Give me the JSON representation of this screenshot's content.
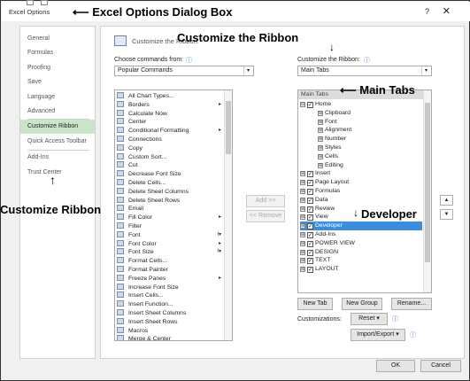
{
  "window": {
    "title": "Excel Options",
    "help": "?",
    "close": "✕"
  },
  "annotations": {
    "dialog": "Excel Options Dialog Box",
    "customize_the_ribbon": "Customize the Ribbon",
    "main_tabs": "Main Tabs",
    "developer": "Developer",
    "customize_ribbon": "Customize Ribbon"
  },
  "sidebar": {
    "items": [
      {
        "label": "General"
      },
      {
        "label": "Formulas"
      },
      {
        "label": "Proofing"
      },
      {
        "label": "Save"
      },
      {
        "label": "Language"
      },
      {
        "label": "Advanced"
      },
      {
        "label": "Customize Ribbon"
      },
      {
        "label": "Quick Access Toolbar"
      },
      {
        "label": "Add-Ins"
      },
      {
        "label": "Trust Center"
      }
    ]
  },
  "main": {
    "header": "Customize the Ribbon.",
    "choose_label": "Choose commands from:",
    "choose_value": "Popular Commands",
    "ribbon_label": "Customize the Ribbon:",
    "ribbon_value": "Main Tabs",
    "commands": [
      {
        "label": "All Chart Types..."
      },
      {
        "label": "Borders",
        "sub": "▸"
      },
      {
        "label": "Calculate Now"
      },
      {
        "label": "Center"
      },
      {
        "label": "Conditional Formatting",
        "sub": "▸"
      },
      {
        "label": "Connections"
      },
      {
        "label": "Copy"
      },
      {
        "label": "Custom Sort..."
      },
      {
        "label": "Cut"
      },
      {
        "label": "Decrease Font Size"
      },
      {
        "label": "Delete Cells..."
      },
      {
        "label": "Delete Sheet Columns"
      },
      {
        "label": "Delete Sheet Rows"
      },
      {
        "label": "Email"
      },
      {
        "label": "Fill Color",
        "sub": "▸"
      },
      {
        "label": "Filter"
      },
      {
        "label": "Font",
        "sub": "I▾"
      },
      {
        "label": "Font Color",
        "sub": "▸"
      },
      {
        "label": "Font Size",
        "sub": "I▾"
      },
      {
        "label": "Format Cells..."
      },
      {
        "label": "Format Painter"
      },
      {
        "label": "Freeze Panes",
        "sub": "▸"
      },
      {
        "label": "Increase Font Size"
      },
      {
        "label": "Insert Cells..."
      },
      {
        "label": "Insert Function..."
      },
      {
        "label": "Insert Sheet Columns"
      },
      {
        "label": "Insert Sheet Rows"
      },
      {
        "label": "Macros"
      },
      {
        "label": "Merge & Center"
      }
    ],
    "tabs_header": "Main Tabs",
    "tree": [
      {
        "label": "Home",
        "level": 0,
        "exp": "⊟",
        "check": true
      },
      {
        "label": "Clipboard",
        "level": 1,
        "exp": "⊞"
      },
      {
        "label": "Font",
        "level": 1,
        "exp": "⊞"
      },
      {
        "label": "Alignment",
        "level": 1,
        "exp": "⊞"
      },
      {
        "label": "Number",
        "level": 1,
        "exp": "⊞"
      },
      {
        "label": "Styles",
        "level": 1,
        "exp": "⊞"
      },
      {
        "label": "Cells",
        "level": 1,
        "exp": "⊞"
      },
      {
        "label": "Editing",
        "level": 1,
        "exp": "⊞"
      },
      {
        "label": "Insert",
        "level": 0,
        "exp": "⊞",
        "check": true
      },
      {
        "label": "Page Layout",
        "level": 0,
        "exp": "⊞",
        "check": true
      },
      {
        "label": "Formulas",
        "level": 0,
        "exp": "⊞",
        "check": true
      },
      {
        "label": "Data",
        "level": 0,
        "exp": "⊞",
        "check": true
      },
      {
        "label": "Review",
        "level": 0,
        "exp": "⊞",
        "check": true
      },
      {
        "label": "View",
        "level": 0,
        "exp": "⊞",
        "check": true
      },
      {
        "label": "Developer",
        "level": 0,
        "exp": "⊞",
        "check": true,
        "selected": true
      },
      {
        "label": "Add-Ins",
        "level": 0,
        "exp": "⊞",
        "check": true
      },
      {
        "label": "POWER VIEW",
        "level": 0,
        "exp": "⊞",
        "check": true
      },
      {
        "label": "DESIGN",
        "level": 0,
        "exp": "⊞",
        "check": true
      },
      {
        "label": "TEXT",
        "level": 0,
        "exp": "⊞",
        "check": true
      },
      {
        "label": "LAYOUT",
        "level": 0,
        "exp": "⊞",
        "check": true
      }
    ],
    "add_button": "Add >>",
    "remove_button": "<< Remove",
    "new_tab": "New Tab",
    "new_group": "New Group",
    "rename": "Rename...",
    "customizations_label": "Customizations:",
    "reset": "Reset ▾",
    "import_export": "Import/Export ▾",
    "up": "▲",
    "down": "▼"
  },
  "footer": {
    "ok": "OK",
    "cancel": "Cancel"
  },
  "colors": {
    "selected": "#3a8ddf",
    "active_sidebar": "#c9e7c8"
  }
}
